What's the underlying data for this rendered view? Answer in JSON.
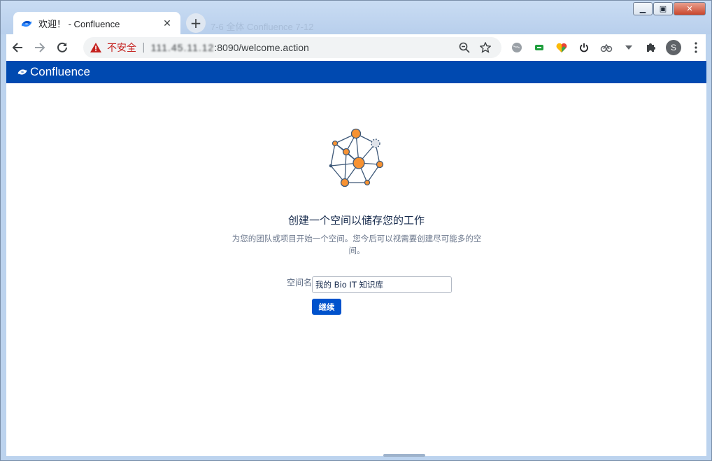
{
  "browser": {
    "tab": {
      "title": "欢迎！ - Confluence",
      "close_glyph": "✕"
    },
    "new_tab_glyph": "+",
    "background_tab_title": "7-6 全体 Confluence 7-12",
    "security_label": "不安全",
    "host": "111.45.11.12",
    "url_path": ":8090/welcome.action",
    "profile_initial": "S",
    "window_controls": {
      "minimize": "▁",
      "maximize": "▣",
      "close": "✕"
    },
    "icons": {
      "back": "back-arrow-icon",
      "forward": "forward-arrow-icon",
      "reload": "reload-icon",
      "warning": "warning-triangle-icon",
      "zoom": "zoom-out-icon",
      "bookmark": "star-icon",
      "extensions": [
        "globe-extension-icon",
        "green-extension-icon",
        "heart-extension-icon",
        "power-extension-icon",
        "link-extension-icon",
        "dropdown-caret-icon",
        "puzzle-icon"
      ],
      "menu": "kebab-menu-icon"
    }
  },
  "app": {
    "brand": "Confluence",
    "brand_color": "#0049b0"
  },
  "main": {
    "heading": "创建一个空间以储存您的工作",
    "description": "为您的团队或项目开始一个空间。您今后可以视需要创建尽可能多的空间。",
    "space_name_label": "空间名",
    "space_name_value": "我的 Bio IT 知识库",
    "continue_label": "继续",
    "button_color": "#0052cc",
    "illustration": "network-nodes-illustration"
  }
}
